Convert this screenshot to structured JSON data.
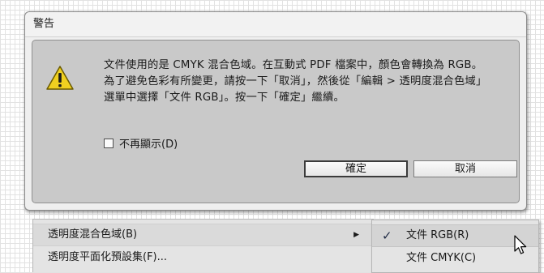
{
  "dialog": {
    "title": "警告",
    "message": "文件使用的是 CMYK 混合色域。在互動式 PDF 檔案中，顏色會轉換為 RGB。為了避免色彩有所變更，請按一下「取消」，然後從「編輯 > 透明度混合色域」選單中選擇「文件 RGB」。按一下「確定」繼續。",
    "checkbox_label": "不再顯示(D)",
    "ok_label": "確定",
    "cancel_label": "取消",
    "icon": "warning-icon"
  },
  "menu": {
    "items": [
      {
        "label": "透明度混合色域(B)"
      },
      {
        "label": "透明度平面化預設集(F)..."
      }
    ]
  },
  "submenu": {
    "items": [
      {
        "label": "文件 RGB(R)",
        "checked": true
      },
      {
        "label": "文件 CMYK(C)",
        "checked": false
      }
    ]
  }
}
